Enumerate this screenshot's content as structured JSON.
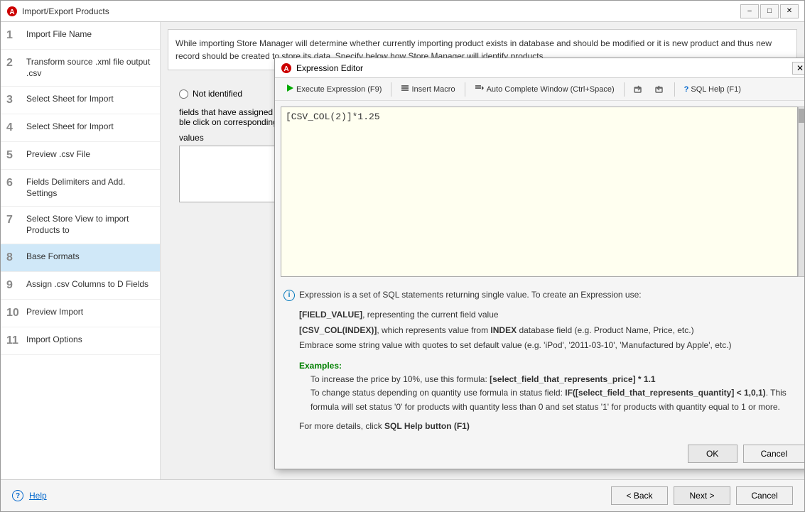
{
  "app": {
    "title": "Import/Export Products"
  },
  "sidebar": {
    "items": [
      {
        "num": "1",
        "label": "Import File Name"
      },
      {
        "num": "2",
        "label": "Transform source .xml file output .csv"
      },
      {
        "num": "3",
        "label": "Select Sheet for Import"
      },
      {
        "num": "4",
        "label": "Select Sheet for Import"
      },
      {
        "num": "5",
        "label": "Preview .csv File"
      },
      {
        "num": "6",
        "label": "Fields Delimiters and Add. Settings"
      },
      {
        "num": "7",
        "label": "Select Store View to import Products to"
      },
      {
        "num": "8",
        "label": "Base Formats"
      },
      {
        "num": "9",
        "label": "Assign .csv Columns to D Fields"
      },
      {
        "num": "10",
        "label": "Preview Import"
      },
      {
        "num": "11",
        "label": "Import Options"
      }
    ]
  },
  "right_panel": {
    "info_text": "While importing Store Manager will determine whether currently importing product exists in database and should be modified or it is new product and thus new record should be created to store its data. Specify below how Store Manager will identify products.",
    "not_identified_label": "Not identified",
    "fields_note": "fields that have assigned .csv\nble click on corresponding column",
    "values_label": "values"
  },
  "dialog": {
    "title": "Expression Editor",
    "toolbar": {
      "execute_label": "Execute Expression (F9)",
      "insert_macro_label": "Insert Macro",
      "auto_complete_label": "Auto Complete Window (Ctrl+Space)",
      "sql_help_label": "SQL Help (F1)"
    },
    "code": "[CSV_COL(2)]*1.25",
    "help": {
      "main_text": "Expression is a set of SQL statements returning single value. To create an Expression use:",
      "field_value": "[FIELD_VALUE]",
      "field_value_desc": ", representing the current field value",
      "csv_col": "[CSV_COL(INDEX)]",
      "csv_col_desc": ", which represents value from",
      "index_label": "INDEX",
      "csv_col_desc2": "database field (e.g. Product Name, Price, etc.)",
      "string_note": "Embrace some string value with quotes to set default value (e.g. 'iPod', '2011-03-10', 'Manufactured by Apple', etc.)",
      "examples_label": "Examples:",
      "example1": "To increase the price by 10%, use this formula:",
      "example1_formula": "[select_field_that_represents_price] * 1.1",
      "example2": "To change status depending on quantity use formula in status field:",
      "example2_formula": "IF([select_field_that_represents_quantity] < 1,0,1)",
      "example2_note": ". This formula will set status '0' for products with quantity less than 0 and set status '1' for products with quantity equal to 1 or more.",
      "more_details": "For more details, click",
      "sql_help_btn": "SQL Help button (F1)"
    },
    "buttons": {
      "ok": "OK",
      "cancel": "Cancel"
    }
  },
  "bottom_bar": {
    "help_label": "Help",
    "back_label": "< Back",
    "next_label": "Next >",
    "cancel_label": "Cancel"
  }
}
